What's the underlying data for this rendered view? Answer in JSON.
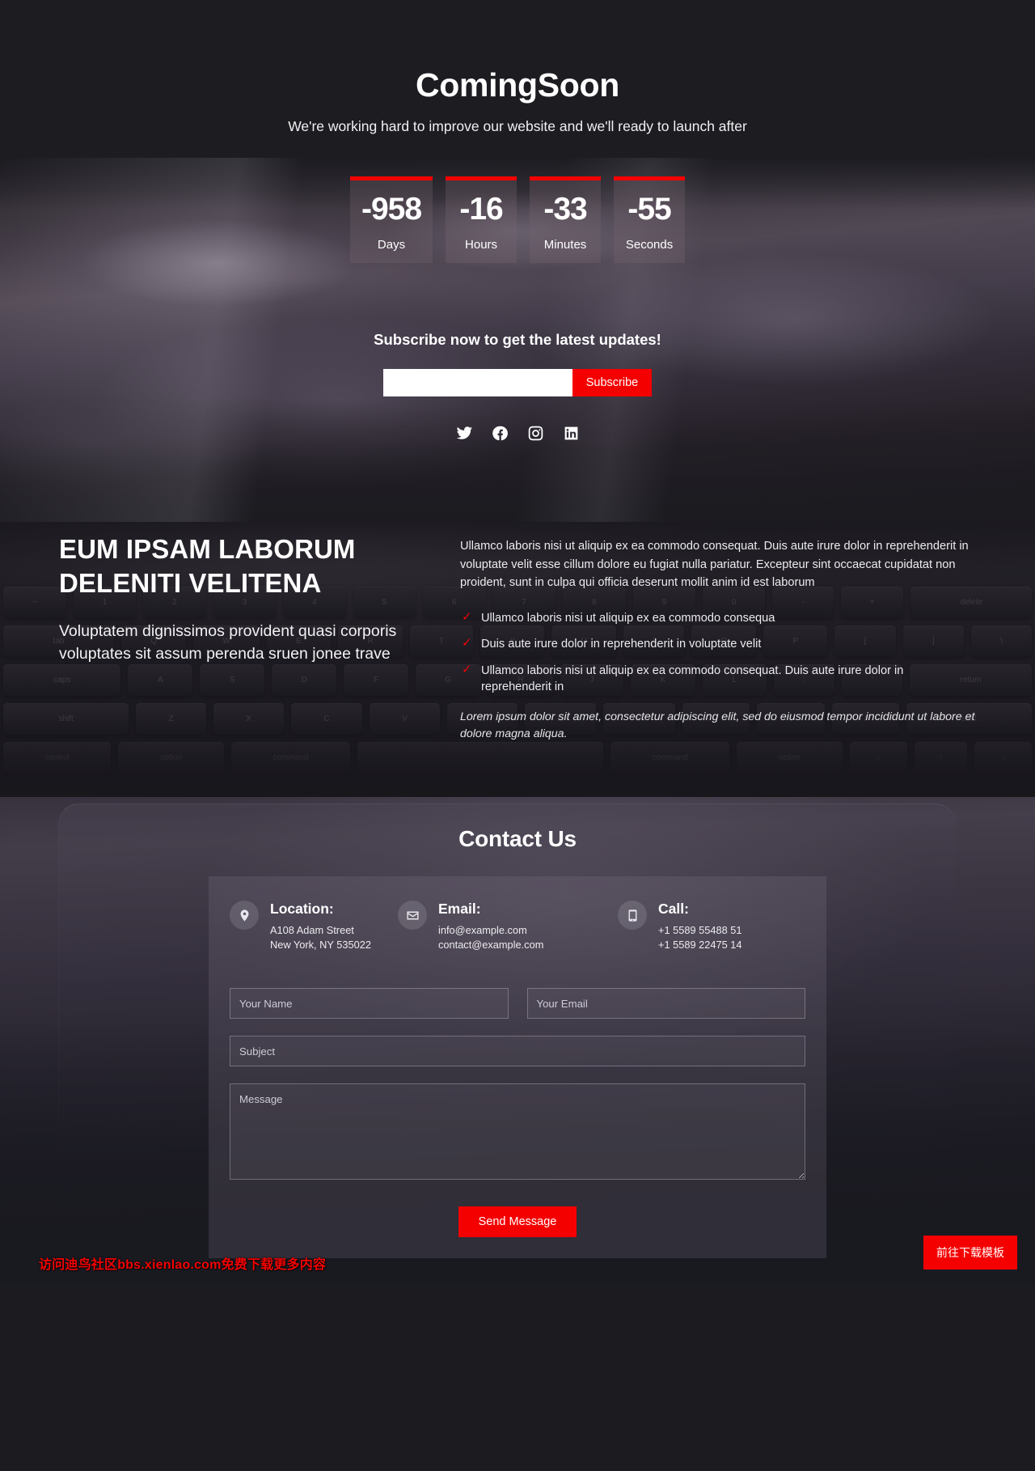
{
  "hero": {
    "title": "ComingSoon",
    "subtitle": "We're working hard to improve our website and we'll ready to launch after",
    "countdown": [
      {
        "value": "-958",
        "label": "Days"
      },
      {
        "value": "-16",
        "label": "Hours"
      },
      {
        "value": "-33",
        "label": "Minutes"
      },
      {
        "value": "-55",
        "label": "Seconds"
      }
    ],
    "subscribe": {
      "title": "Subscribe now to get the latest updates!",
      "input_value": "",
      "input_placeholder": "",
      "button_label": "Subscribe"
    },
    "socials": [
      {
        "name": "twitter-icon",
        "label": "Twitter"
      },
      {
        "name": "facebook-icon",
        "label": "Facebook"
      },
      {
        "name": "instagram-icon",
        "label": "Instagram"
      },
      {
        "name": "linkedin-icon",
        "label": "LinkedIn"
      }
    ]
  },
  "about": {
    "heading": "EUM IPSAM LABORUM DELENITI VELITENA",
    "subheading": "Voluptatem dignissimos provident quasi corporis voluptates sit assum perenda sruen jonee trave",
    "lead": "Ullamco laboris nisi ut aliquip ex ea commodo consequat. Duis aute irure dolor in reprehenderit in voluptate velit esse cillum dolore eu fugiat nulla pariatur. Excepteur sint occaecat cupidatat non proident, sunt in culpa qui officia deserunt mollit anim id est laborum",
    "checklist": [
      "Ullamco laboris nisi ut aliquip ex ea commodo consequa",
      "Duis aute irure dolor in reprehenderit in voluptate velit",
      "Ullamco laboris nisi ut aliquip ex ea commodo consequat. Duis aute irure dolor in reprehenderit in"
    ],
    "italic_note": "Lorem ipsum dolor sit amet, consectetur adipiscing elit, sed do eiusmod tempor incididunt ut labore et dolore magna aliqua."
  },
  "contact": {
    "title": "Contact Us",
    "location": {
      "heading": "Location:",
      "line1": "A108 Adam Street",
      "line2": "New York, NY 535022"
    },
    "email": {
      "heading": "Email:",
      "line1": "info@example.com",
      "line2": "contact@example.com"
    },
    "call": {
      "heading": "Call:",
      "line1": "+1 5589 55488 51",
      "line2": "+1 5589 22475 14"
    },
    "form": {
      "name_placeholder": "Your Name",
      "name_value": "",
      "email_placeholder": "Your Email",
      "email_value": "",
      "subject_placeholder": "Subject",
      "subject_value": "",
      "message_placeholder": "Message",
      "message_value": "",
      "submit_label": "Send Message"
    }
  },
  "overlays": {
    "watermark": "访问迪鸟社区bbs.xienlao.com免费下载更多内容",
    "download_button": "前往下载模板"
  },
  "colors": {
    "accent": "#f40000",
    "page_bg": "#1b1b20",
    "text": "#ffffff"
  },
  "keyboard_rows": [
    [
      "~",
      "1",
      "2",
      "3",
      "4",
      "5",
      "6",
      "7",
      "8",
      "9",
      "0",
      "-",
      "+",
      "delete"
    ],
    [
      "tab",
      "Q",
      "W",
      "E",
      "R",
      "T",
      "Y",
      "U",
      "I",
      "O",
      "P",
      "[",
      "]",
      "\\"
    ],
    [
      "caps",
      "A",
      "S",
      "D",
      "F",
      "G",
      "H",
      "J",
      "K",
      "L",
      ";",
      "'",
      "return"
    ],
    [
      "shift",
      "Z",
      "X",
      "C",
      "V",
      "B",
      "N",
      "M",
      ",",
      ".",
      "/",
      "shift"
    ],
    [
      "control",
      "option",
      "command",
      "",
      "command",
      "option",
      "←",
      "↑",
      "→"
    ]
  ]
}
